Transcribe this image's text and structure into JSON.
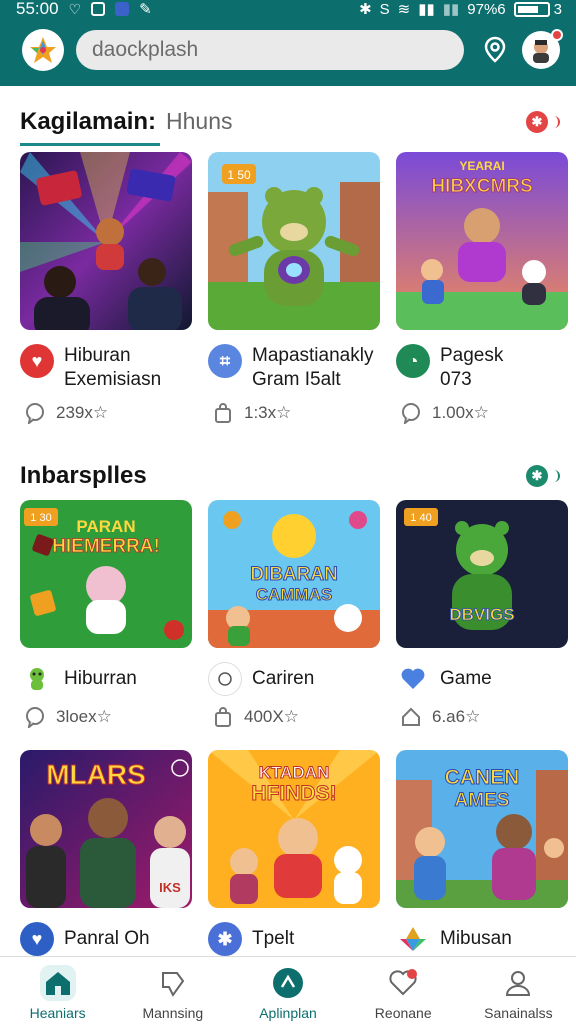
{
  "status": {
    "time": "55:00",
    "right": "S",
    "battery_text": "97%6",
    "battery_num": "3"
  },
  "search": {
    "placeholder": "daockplash"
  },
  "section1": {
    "title": "Kagilamain:",
    "subtitle": "Hhuns"
  },
  "section2": {
    "title": "Inbarsplles"
  },
  "row1": [
    {
      "name": "Hiburan\nExemisiasn",
      "icon_color": "#e03535",
      "icon": "heart-icon",
      "count": "239x☆",
      "stat_icon": "comment-icon"
    },
    {
      "name": "Mapastianakly\nGram I5alt",
      "icon_color": "#5a86e0",
      "icon": "hash-icon",
      "count": "1:3x☆",
      "stat_icon": "bag-icon"
    },
    {
      "name": "Pagesk\n073",
      "icon_color": "#1f8a55",
      "icon": "chat-icon",
      "count": "1.00x☆",
      "stat_icon": "comment-icon"
    }
  ],
  "row2": [
    {
      "name": "Hiburran",
      "icon_color": "#6bbf3a",
      "icon": "creature-icon",
      "count": "3loex☆",
      "stat_icon": "comment-icon"
    },
    {
      "name": "Cariren",
      "icon_color": "#ffffff",
      "icon": "circle-icon",
      "count": "400X☆",
      "stat_icon": "bag-icon"
    },
    {
      "name": "Game",
      "icon_color": "#ffffff",
      "icon": "heart-icon",
      "count": "6.a6☆",
      "stat_icon": "home-icon"
    }
  ],
  "row3": [
    {
      "name": "Panral Oh",
      "icon_color": "#2e5fc4",
      "icon": "heart-icon"
    },
    {
      "name": "Tpelt",
      "icon_color": "#4a6fd6",
      "icon": "bluetooth-icon"
    },
    {
      "name": "Mibusan",
      "icon_color": "#ffffff",
      "icon": "colorful-logo-icon"
    }
  ],
  "thumb_text": {
    "t2_badge": "1 50",
    "t3": "HIBXCMRS",
    "t3_top": "YEARAI",
    "t4_badge": "1 30",
    "t4_line1": "PARAN",
    "t4_line2": "HIEMERRA!",
    "t5_line1": "DIBARAN",
    "t5_line2": "CAMMAS",
    "t6_badge": "1 40",
    "t6": "DBVIGS",
    "t7": "MLARS",
    "t7_sub": "IKS",
    "t8_line1": "KTADAN",
    "t8_line2": "HFINDS!",
    "t9_line1": "CANEN",
    "t9_line2": "AMES"
  },
  "nav": [
    {
      "label": "Heaniars",
      "active": true
    },
    {
      "label": "Mannsing",
      "active": false
    },
    {
      "label": "Aplinplan",
      "active": true
    },
    {
      "label": "Reonane",
      "active": false
    },
    {
      "label": "Sanainalss",
      "active": false
    }
  ],
  "colors": {
    "header": "#0d6e6e",
    "accent": "#1c8a8a",
    "badge_red": "#e34444",
    "badge_green": "#1c8a6c"
  }
}
